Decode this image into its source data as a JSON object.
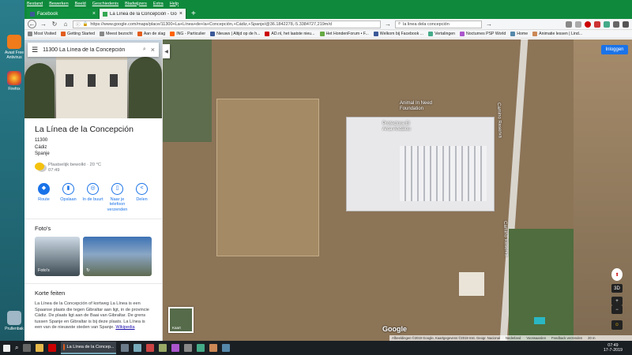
{
  "desktop": {
    "icons": [
      {
        "label": "Avast Free Antivirus",
        "color": "#f07b1b"
      },
      {
        "label": "Firefox",
        "color": "#e35d1d"
      },
      {
        "label": "Prullenbak",
        "color": "#9fb7c6"
      }
    ]
  },
  "browser": {
    "menu": [
      "Bestand",
      "Bewerken",
      "Beeld",
      "Geschiedenis",
      "Bladwijzers",
      "Extra",
      "Help"
    ],
    "tabs": [
      {
        "label": "Facebook",
        "close": "×"
      },
      {
        "label": "La Línea de la Concepción - Go",
        "close": "×"
      }
    ],
    "new_tab": "+",
    "url": "https://www.google.com/maps/place/11300+La+Línea+de+la+Concepción,+Cádiz,+Spanje/@36.1842278,-5.3384727,219m/d",
    "search_value": "la linea dela concepción",
    "bookmarks": [
      {
        "label": "Most Visited",
        "color": "#888"
      },
      {
        "label": "Getting Started",
        "color": "#e35d1d"
      },
      {
        "label": "Meest bezocht",
        "color": "#888"
      },
      {
        "label": "Aan de slag",
        "color": "#e35d1d"
      },
      {
        "label": "ING - Particulier",
        "color": "#ff6200"
      },
      {
        "label": "Nieuws | Altijd op de h...",
        "color": "#3b5998"
      },
      {
        "label": "AD.nl, het laatste nieu...",
        "color": "#c00"
      },
      {
        "label": "Het HondenForum • F...",
        "color": "#6a4"
      },
      {
        "label": "Welkom bij Facebook ...",
        "color": "#3b5998"
      },
      {
        "label": "Vertalingen",
        "color": "#4a8"
      },
      {
        "label": "Nocturnes PSP World",
        "color": "#a5c"
      },
      {
        "label": "Home",
        "color": "#58a"
      },
      {
        "label": "Animatie lessen | Lind...",
        "color": "#c85"
      }
    ]
  },
  "maps": {
    "search_value": "11300 La Línea de la Concepción",
    "collapse_glyph": "◀",
    "login_label": "Inloggen",
    "place": {
      "title": "La Línea de la Concepción",
      "address": [
        "11300",
        "Cádiz",
        "Spanje"
      ],
      "weather": "Plaatselijk bewolkt · 20 °C",
      "weather_time": "07:49"
    },
    "actions": [
      {
        "icon": "◆",
        "label": "Route"
      },
      {
        "icon": "▮",
        "label": "Opslaan"
      },
      {
        "icon": "◎",
        "label": "In de buurt"
      },
      {
        "icon": "▯",
        "label": "Naar je telefoon verzenden"
      },
      {
        "icon": "<",
        "label": "Delen"
      }
    ],
    "photos_heading": "Foto's",
    "photos_label": "Foto's",
    "facts_heading": "Korte feiten",
    "facts_text": "La Línea de la Concepción of kortweg La Línea is een Spaanse plaats die tegen Gibraltar aan ligt, in de provincie Cádiz. De plaats ligt aan de Baai van Gibraltar. De grens tussen Spanje en Gibraltar is bij deze plaats. La Línea is een van de nieuwste steden van Spanje.",
    "facts_link": "Wikipedia",
    "map_labels": {
      "animal": "Animal In Need Foundation",
      "protectora": "Protectora El Arca Andalou",
      "road_1": "Camino Reserva",
      "road_2": "Camino Reserva"
    },
    "controls": {
      "compass": "⬆",
      "mode": "3D",
      "zoom_in": "+",
      "zoom_out": "−",
      "pegman": "☺"
    },
    "google": "Google",
    "minimap_label": "Kaart",
    "footer": [
      "Afbeeldingen ©2019 Google, Kaartgegevens ©2019 Inst. Geogr. Nacional",
      "Nederland",
      "Voorwaarden",
      "Feedback verzenden",
      "20 m"
    ]
  },
  "taskbar": {
    "active_task": "La Línea de la Concep...",
    "time": "07:49",
    "date": "17-7-2019"
  }
}
